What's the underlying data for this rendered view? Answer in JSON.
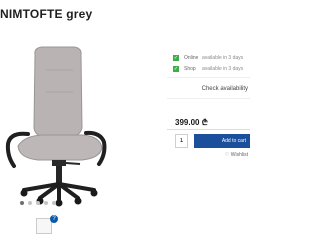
{
  "product": {
    "title": "NIMTOFTE grey"
  },
  "gallery": {
    "image_alt": "office chair",
    "dots": 5,
    "active_dot": 1,
    "thumb_badge": "?"
  },
  "stock": [
    {
      "name": "Online",
      "status": "available in 3 days",
      "check": "✓"
    },
    {
      "name": "Shop",
      "status": "available in 3 days",
      "check": "✓"
    }
  ],
  "panel": {
    "check_link": "Check availability",
    "price": "399.00 ₾",
    "quantity": "1",
    "add_to_cart": "Add to cart",
    "wishlist": "♡ Wishlist"
  },
  "colors": {
    "accent": "#1b4e9b",
    "in_stock": "#3fae49",
    "chair_fabric": "#b9b4b3"
  }
}
